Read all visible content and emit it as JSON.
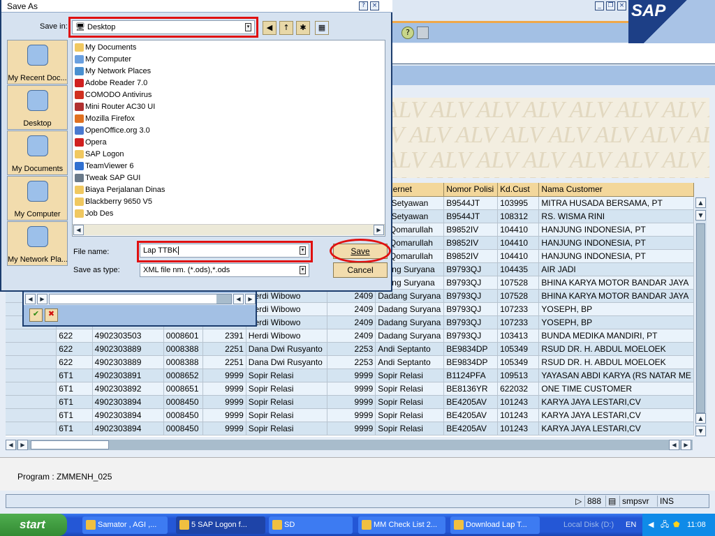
{
  "sap": {
    "logo": "SAP",
    "toolbar_icons": [
      "help-icon",
      "layout-icon"
    ]
  },
  "alv_banner": {
    "watermark": "ALV"
  },
  "grid": {
    "headers": [
      "",
      "",
      "",
      "",
      "",
      "",
      "",
      "m.Kernet",
      "Nomor Polisi",
      "Kd.Cust",
      "Nama Customer"
    ],
    "rows": [
      [
        "",
        "",
        "",
        "",
        "",
        "",
        "",
        "udi Setyawan",
        "B9544JT",
        "103995",
        "MITRA HUSADA BERSAMA, PT"
      ],
      [
        "",
        "",
        "",
        "",
        "",
        "",
        "",
        "udi Setyawan",
        "B9544JT",
        "108312",
        "RS. WISMA RINI"
      ],
      [
        "",
        "",
        "",
        "",
        "",
        "",
        "",
        "an Qomarullah",
        "B9852IV",
        "104410",
        "HANJUNG INDONESIA, PT"
      ],
      [
        "",
        "",
        "",
        "",
        "",
        "",
        "",
        "an Qomarullah",
        "B9852IV",
        "104410",
        "HANJUNG INDONESIA, PT"
      ],
      [
        "",
        "",
        "",
        "",
        "",
        "",
        "",
        "an Qomarullah",
        "B9852IV",
        "104410",
        "HANJUNG INDONESIA, PT"
      ],
      [
        "",
        "",
        "",
        "",
        "",
        "",
        "",
        "adang Suryana",
        "B9793QJ",
        "104435",
        "AIR JADI"
      ],
      [
        "",
        "",
        "",
        "",
        "",
        "",
        "",
        "adang Suryana",
        "B9793QJ",
        "107528",
        "BHINA KARYA MOTOR BANDAR JAYA"
      ],
      [
        "",
        "",
        "",
        "",
        "",
        "Herdi Wibowo",
        "2409",
        "Dadang Suryana",
        "B9793QJ",
        "107528",
        "BHINA KARYA MOTOR BANDAR JAYA"
      ],
      [
        "",
        "",
        "",
        "",
        "",
        "Herdi Wibowo",
        "2409",
        "Dadang Suryana",
        "B9793QJ",
        "107233",
        "YOSEPH, BP"
      ],
      [
        "",
        "",
        "",
        "",
        "",
        "Herdi Wibowo",
        "2409",
        "Dadang Suryana",
        "B9793QJ",
        "107233",
        "YOSEPH, BP"
      ],
      [
        "",
        "622",
        "4902303503",
        "0008601",
        "2391",
        "Herdi Wibowo",
        "2409",
        "Dadang Suryana",
        "B9793QJ",
        "103413",
        "BUNDA MEDIKA MANDIRI, PT"
      ],
      [
        "",
        "622",
        "4902303889",
        "0008388",
        "2251",
        "Dana Dwi Rusyanto",
        "2253",
        "Andi Septanto",
        "BE9834DP",
        "105349",
        "RSUD DR. H. ABDUL MOELOEK"
      ],
      [
        "",
        "622",
        "4902303889",
        "0008388",
        "2251",
        "Dana Dwi Rusyanto",
        "2253",
        "Andi Septanto",
        "BE9834DP",
        "105349",
        "RSUD DR. H. ABDUL MOELOEK"
      ],
      [
        "",
        "6T1",
        "4902303891",
        "0008652",
        "9999",
        "Sopir Relasi",
        "9999",
        "Sopir Relasi",
        "B1124PFA",
        "109513",
        "YAYASAN ABDI KARYA (RS NATAR ME"
      ],
      [
        "",
        "6T1",
        "4902303892",
        "0008651",
        "9999",
        "Sopir Relasi",
        "9999",
        "Sopir Relasi",
        "BE8136YR",
        "622032",
        "ONE TIME CUSTOMER"
      ],
      [
        "",
        "6T1",
        "4902303894",
        "0008450",
        "9999",
        "Sopir Relasi",
        "9999",
        "Sopir Relasi",
        "BE4205AV",
        "101243",
        "KARYA JAYA LESTARI,CV"
      ],
      [
        "",
        "6T1",
        "4902303894",
        "0008450",
        "9999",
        "Sopir Relasi",
        "9999",
        "Sopir Relasi",
        "BE4205AV",
        "101243",
        "KARYA JAYA LESTARI,CV"
      ],
      [
        "",
        "6T1",
        "4902303894",
        "0008450",
        "9999",
        "Sopir Relasi",
        "9999",
        "Sopir Relasi",
        "BE4205AV",
        "101243",
        "KARYA JAYA LESTARI,CV"
      ]
    ]
  },
  "program_label": "Program : ZMMENH_025",
  "statusbar": {
    "client": "888",
    "server": "smpsvr",
    "mode": "INS"
  },
  "dialog": {
    "title": "Save As",
    "save_in_label": "Save in:",
    "save_in_value": "Desktop",
    "places": [
      "My Recent Doc...",
      "Desktop",
      "My Documents",
      "My Computer",
      "My Network Pla..."
    ],
    "files": [
      "My Documents",
      "My Computer",
      "My Network Places",
      "Adobe Reader 7.0",
      "COMODO Antivirus",
      "Mini Router AC30 UI",
      "Mozilla Firefox",
      "OpenOffice.org 3.0",
      "Opera",
      "SAP Logon",
      "TeamViewer 6",
      "Tweak SAP GUI",
      "Biaya Perjalanan Dinas",
      "Blackberry 9650 V5",
      "Job Des"
    ],
    "file_name_label": "File name:",
    "file_name_value": "Lap TTBK",
    "save_type_label": "Save as type:",
    "save_type_value": "XML file nm. (*.ods),*.ods",
    "save_button": "Save",
    "cancel_button": "Cancel",
    "highlight_color": "#e01010"
  },
  "taskbar": {
    "start": "start",
    "tasks": [
      "Samator , AGI ,...",
      "5 SAP Logon f...",
      "SD",
      "MM Check List 2...",
      "Download Lap T...",
      "Local Disk (D:)"
    ],
    "language": "EN",
    "clock": "11:08"
  }
}
